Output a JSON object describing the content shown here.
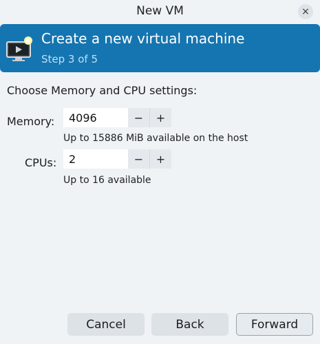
{
  "window": {
    "title": "New VM",
    "close_glyph": "×"
  },
  "banner": {
    "title": "Create a new virtual machine",
    "step": "Step 3 of 5",
    "icon": "monitor-with-star-icon",
    "color": "#1575b0"
  },
  "form": {
    "heading": "Choose Memory and CPU settings:",
    "memory": {
      "label": "Memory:",
      "value": "4096",
      "minus": "−",
      "plus": "+",
      "hint": "Up to 15886 MiB available on the host"
    },
    "cpus": {
      "label": "CPUs:",
      "value": "2",
      "minus": "−",
      "plus": "+",
      "hint": "Up to 16 available"
    }
  },
  "footer": {
    "cancel_label": "Cancel",
    "back_label": "Back",
    "forward_label": "Forward"
  }
}
